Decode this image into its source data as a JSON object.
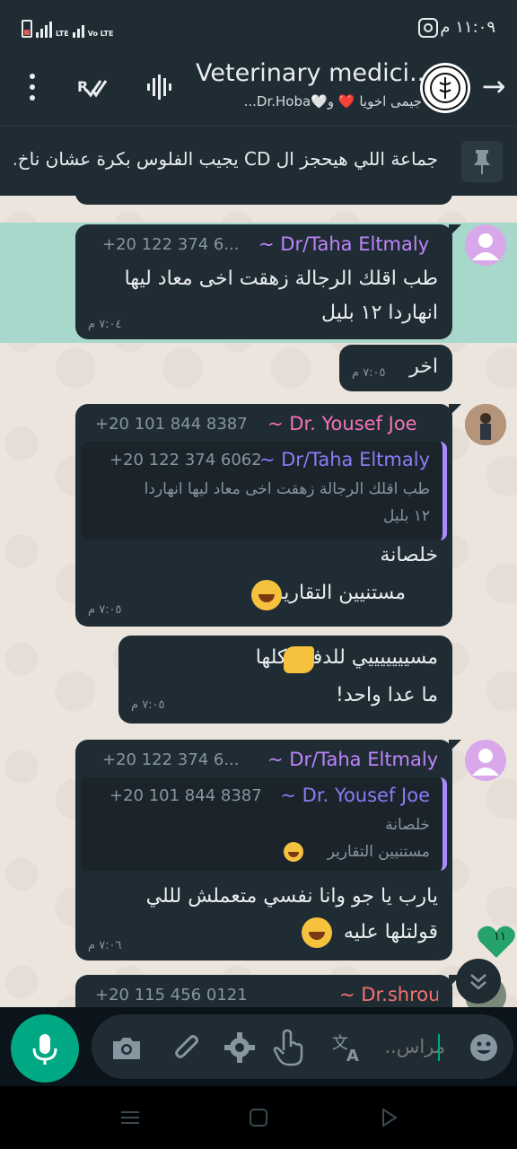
{
  "status_bar": {
    "time": "١١:٠٩ م",
    "network": "LTE",
    "volte": "Vo LTE"
  },
  "header": {
    "title": "Veterinary medici...",
    "subtitle": "جيمى اخويا ❤️ و🤍Dr.Hoba..."
  },
  "pinned": {
    "text": "جماعة اللي هيحجز ال CD يجيب الفلوس بكرة عشان ناخ..."
  },
  "messages": [
    {
      "sender": "~ Dr/Taha Eltmaly",
      "phone": "+20 122 374 6...",
      "lines": [
        "طب اقلك الرجالة زهقت اخى معاد ليها",
        "انهاردا ١٢ بليل"
      ],
      "time": "٧:٠٤ م"
    },
    {
      "lines": [
        "اخر"
      ],
      "time": "٧:٠٥ م"
    },
    {
      "sender": "~ Dr. Yousef Joe",
      "phone": "+20 101 844 8387",
      "quote": {
        "sender": "~ Dr/Taha Eltmaly",
        "phone": "+20 122 374 6062",
        "lines": [
          "طب اقلك الرجالة زهقت اخى معاد ليها انهاردا",
          "١٢ بليل"
        ]
      },
      "lines": [
        "خلصانة",
        "مستنيين التقارير"
      ],
      "time": "٧:٠٥ م"
    },
    {
      "lines": [
        "مسيييييييي للدفعة كلها",
        "ما عدا واحد!"
      ],
      "time": "٧:٠٥ م"
    },
    {
      "sender": "~ Dr/Taha Eltmaly",
      "phone": "+20 122 374 6...",
      "quote": {
        "sender": "~ Dr. Yousef Joe",
        "phone": "+20 101 844 8387",
        "lines": [
          "خلصانة",
          "مستنيين التقارير"
        ]
      },
      "lines": [
        "يارب يا جو وانا نفسي متعملش لللي",
        "قولتلها عليه"
      ],
      "time": "٧:٠٦ م"
    },
    {
      "sender": "~ Dr.shroul",
      "phone": "+20 115 456 0121"
    }
  ],
  "reaction": {
    "count": "١١"
  },
  "input": {
    "placeholder": "مراس.."
  },
  "colors": {
    "accent": "#00a884",
    "name_purple": "#c084fc",
    "name_pink": "#f472b6",
    "name_red": "#f87171"
  }
}
